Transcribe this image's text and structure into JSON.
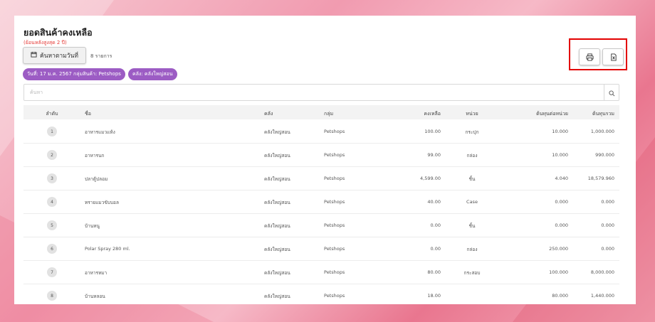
{
  "page": {
    "title": "ยอดสินค้าคงเหลือ",
    "subnote": "(ย้อนหลังสูงสุด 2 ปี)",
    "date_button": "ค้นหาตามวันที่",
    "count_text": "8 รายการ",
    "chips": [
      "วันที่: 17 ม.ค. 2567 กลุ่มสินค้า: Petshops",
      "คลัง: คลังใหญ่สอน"
    ],
    "search_placeholder": "ค้นหา"
  },
  "icons": {
    "print": "printer-icon",
    "export": "excel-icon",
    "search": "search-icon",
    "calendar": "calendar-icon"
  },
  "colors": {
    "accent": "#9c5cc4",
    "highlight": "#e30000",
    "note": "#e53935"
  },
  "table": {
    "headers": {
      "no": "ลำดับ",
      "name": "ชื่อ",
      "warehouse": "คลัง",
      "group": "กลุ่ม",
      "remaining": "คงเหลือ",
      "unit": "หน่วย",
      "unit_cost": "ต้นทุนต่อหน่วย",
      "total_cost": "ต้นทุนรวม"
    },
    "rows": [
      {
        "no": "1",
        "name": "อาหารแมวแห้ง",
        "warehouse": "คลังใหญ่สอน",
        "group": "Petshops",
        "remaining": "100.00",
        "unit": "กระปุก",
        "unit_cost": "10.000",
        "total_cost": "1,000.000"
      },
      {
        "no": "2",
        "name": "อาหารนก",
        "warehouse": "คลังใหญ่สอน",
        "group": "Petshops",
        "remaining": "99.00",
        "unit": "กล่อง",
        "unit_cost": "10.000",
        "total_cost": "990.000"
      },
      {
        "no": "3",
        "name": "ปลาตู้ปลอม",
        "warehouse": "คลังใหญ่สอน",
        "group": "Petshops",
        "remaining": "4,599.00",
        "unit": "ชิ้น",
        "unit_cost": "4.040",
        "total_cost": "18,579.960"
      },
      {
        "no": "4",
        "name": "ทรายแมวขับบอล",
        "warehouse": "คลังใหญ่สอน",
        "group": "Petshops",
        "remaining": "40.00",
        "unit": "Case",
        "unit_cost": "0.000",
        "total_cost": "0.000"
      },
      {
        "no": "5",
        "name": "บ้านหนู",
        "warehouse": "คลังใหญ่สอน",
        "group": "Petshops",
        "remaining": "0.00",
        "unit": "ชิ้น",
        "unit_cost": "0.000",
        "total_cost": "0.000"
      },
      {
        "no": "6",
        "name": "Polar Spray 280 ml.",
        "warehouse": "คลังใหญ่สอน",
        "group": "Petshops",
        "remaining": "0.00",
        "unit": "กล่อง",
        "unit_cost": "250.000",
        "total_cost": "0.000"
      },
      {
        "no": "7",
        "name": "อาหารหมา",
        "warehouse": "คลังใหญ่สอน",
        "group": "Petshops",
        "remaining": "80.00",
        "unit": "กระสอบ",
        "unit_cost": "100.000",
        "total_cost": "8,000.000"
      },
      {
        "no": "8",
        "name": "บ้านหลอน",
        "warehouse": "คลังใหญ่สอน",
        "group": "Petshops",
        "remaining": "18.00",
        "unit": "",
        "unit_cost": "80.000",
        "total_cost": "1,440.000"
      }
    ]
  }
}
